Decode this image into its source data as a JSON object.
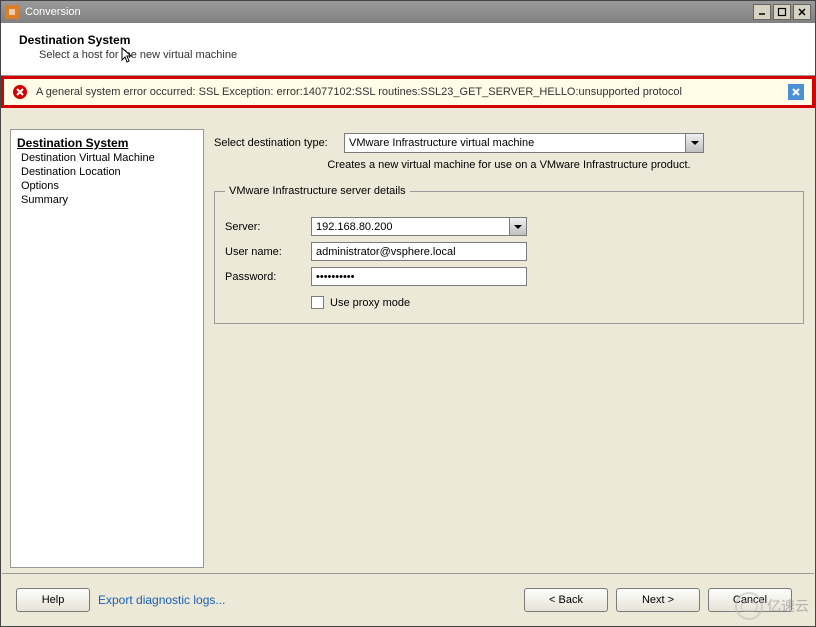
{
  "window": {
    "title": "Conversion"
  },
  "header": {
    "title": "Destination System",
    "subtitle": "Select a host for the new virtual machine"
  },
  "error": {
    "message": "A general system error occurred: SSL Exception: error:14077102:SSL routines:SSL23_GET_SERVER_HELLO:unsupported protocol"
  },
  "sidebar": {
    "title": "Destination System",
    "items": [
      "Destination Virtual Machine",
      "Destination Location",
      "Options",
      "Summary"
    ]
  },
  "main": {
    "dest_type_label": "Select destination type:",
    "dest_type_value": "VMware Infrastructure virtual machine",
    "description": "Creates a new virtual machine for use on a VMware Infrastructure product.",
    "group_title": "VMware Infrastructure server details",
    "server_label": "Server:",
    "server_value": "192.168.80.200",
    "username_label": "User name:",
    "username_value": "administrator@vsphere.local",
    "password_label": "Password:",
    "password_value": "••••••••••",
    "proxy_label": "Use proxy mode",
    "proxy_checked": false
  },
  "footer": {
    "help": "Help",
    "export": "Export diagnostic logs...",
    "back": "< Back",
    "next": "Next >",
    "cancel": "Cancel"
  },
  "watermark": "亿速云"
}
